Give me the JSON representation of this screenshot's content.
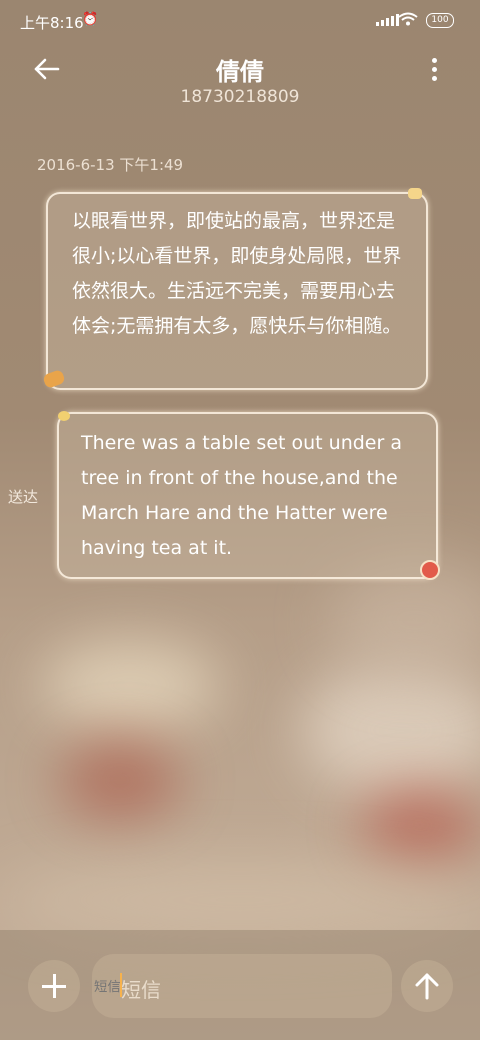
{
  "status_bar": {
    "time": "上午8:16",
    "alarm_icon": "alarm-icon",
    "signal_icon": "signal-icon",
    "wifi_icon": "wifi-icon",
    "battery": "100"
  },
  "header": {
    "back_icon": "back-arrow-icon",
    "contact_name": "倩倩",
    "phone_number": "18730218809",
    "more_icon": "more-vertical-icon"
  },
  "conversation": {
    "timestamp": "2016-6-13 下午1:49",
    "messages": [
      {
        "direction": "incoming",
        "text": "以眼看世界，即使站的最高，世界还是很小;以心看世界，即使身处局限，世界依然很大。生活远不完美，需要用心去体会;无需拥有太多，愿快乐与你相随。"
      },
      {
        "direction": "outgoing",
        "text": "There was a table set out under a tree in front of the house,and the March Hare and the Hatter were having tea at it.",
        "status": "送达"
      }
    ]
  },
  "composer": {
    "add_icon": "plus-icon",
    "placeholder": "短信",
    "send_icon": "send-arrow-up-icon"
  },
  "colors": {
    "text_primary": "#ffffff",
    "bubble_border": "#fff4e6",
    "cursor": "#f7b24c"
  }
}
